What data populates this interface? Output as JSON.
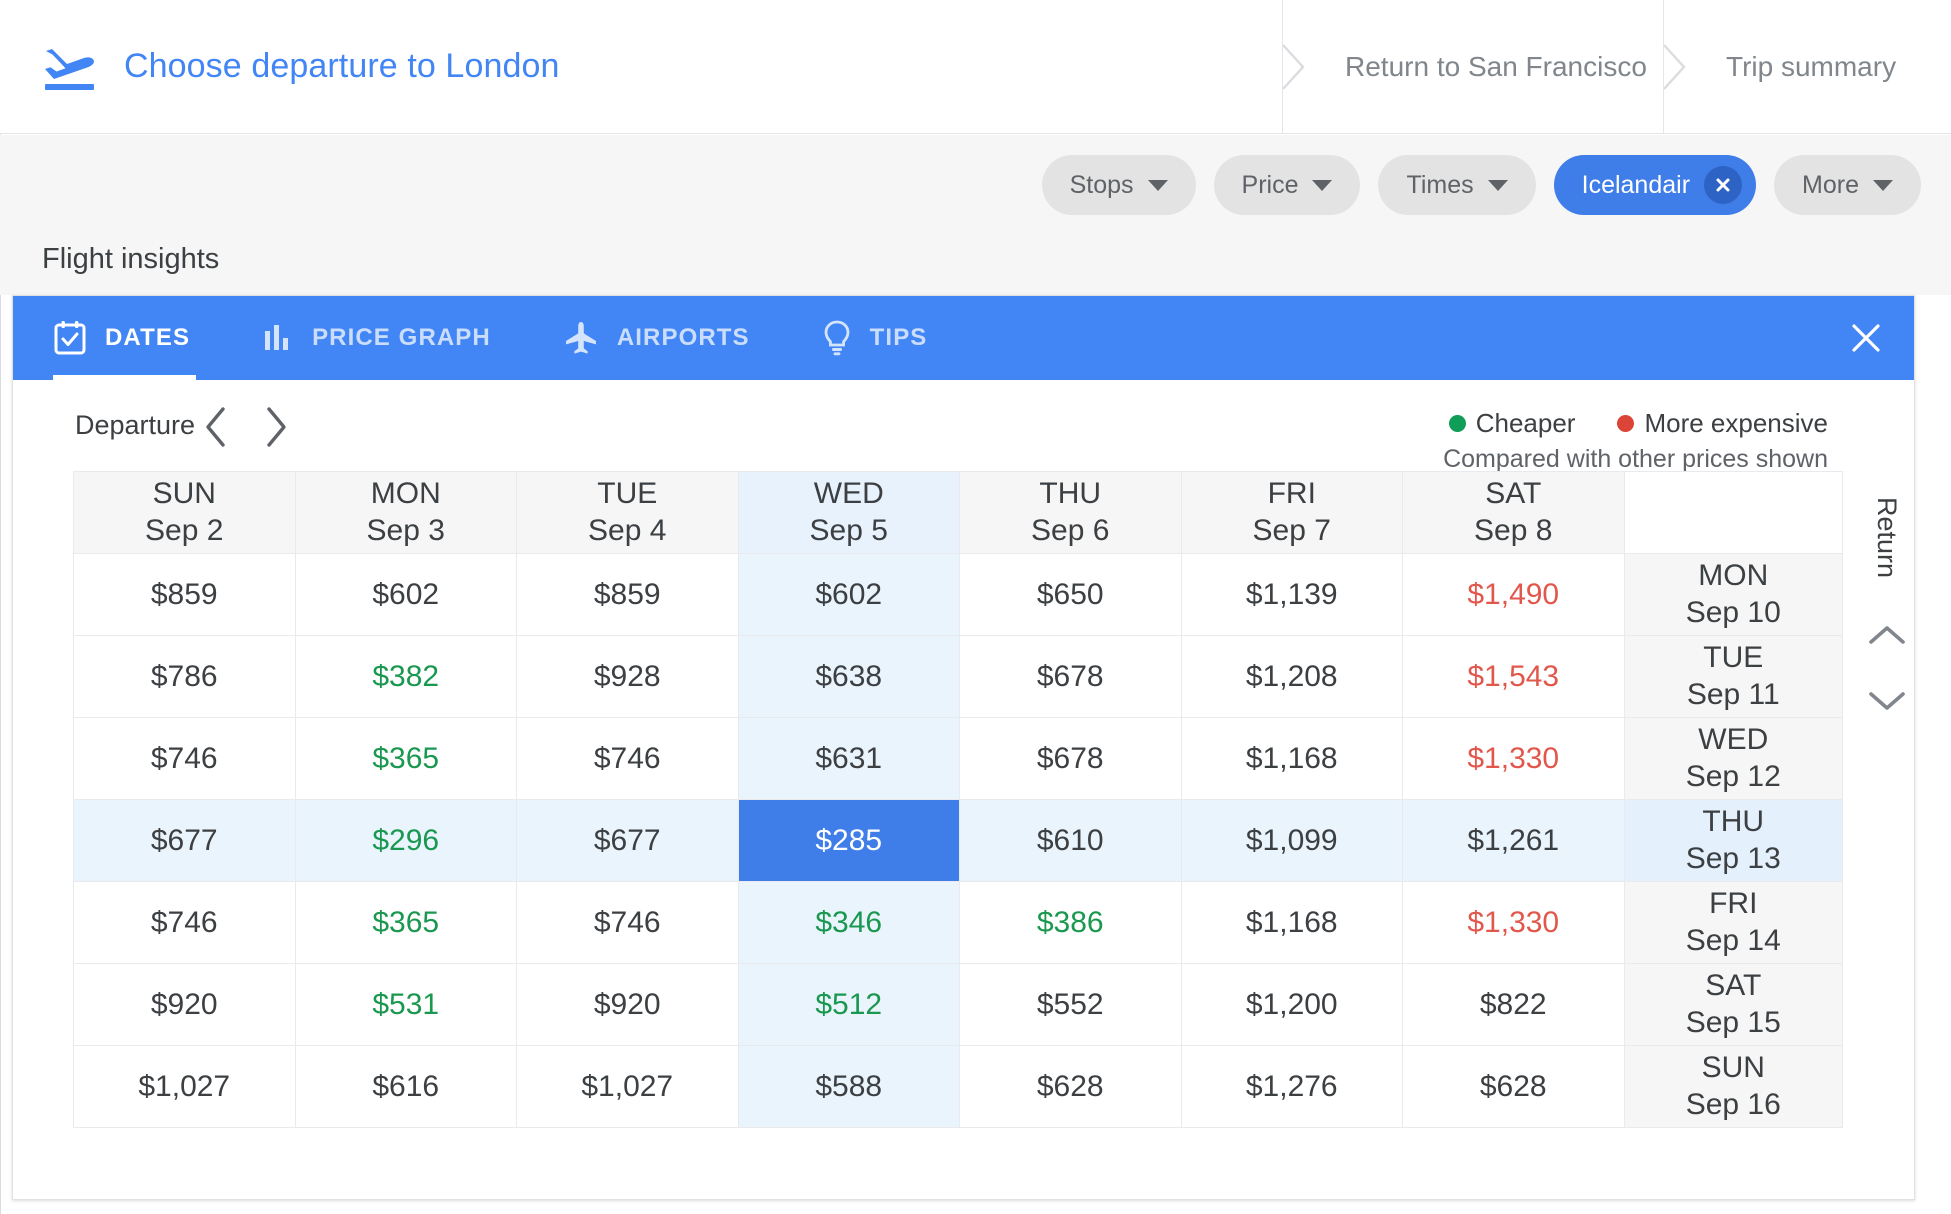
{
  "header": {
    "plane_icon": "airplane-landing-icon",
    "active_crumb": "Choose departure to London",
    "crumbs": [
      {
        "label": "Return to San Francisco"
      },
      {
        "label": "Trip summary"
      }
    ]
  },
  "filters": {
    "chips": [
      {
        "label": "Stops",
        "type": "dropdown",
        "active": false
      },
      {
        "label": "Price",
        "type": "dropdown",
        "active": false
      },
      {
        "label": "Times",
        "type": "dropdown",
        "active": false
      },
      {
        "label": "Icelandair",
        "type": "removable",
        "active": true
      },
      {
        "label": "More",
        "type": "dropdown",
        "active": false
      }
    ]
  },
  "insights": {
    "title": "Flight insights",
    "tabs": [
      {
        "label": "DATES",
        "icon": "calendar-check-icon",
        "selected": true
      },
      {
        "label": "PRICE GRAPH",
        "icon": "bar-chart-icon",
        "selected": false
      },
      {
        "label": "AIRPORTS",
        "icon": "airplane-icon",
        "selected": false
      },
      {
        "label": "TIPS",
        "icon": "lightbulb-icon",
        "selected": false
      }
    ],
    "close_label": "close-icon"
  },
  "controls": {
    "departure_label": "Departure",
    "prev_label": "chevron-left-icon",
    "next_label": "chevron-right-icon",
    "legend": {
      "cheaper": "Cheaper",
      "more_expensive": "More expensive",
      "note": "Compared with other prices shown",
      "cheaper_color": "#0f9d58",
      "expensive_color": "#db4437"
    }
  },
  "rail": {
    "label": "Return",
    "up_label": "chevron-up-icon",
    "down_label": "chevron-down-icon"
  },
  "grid": {
    "columns": [
      {
        "dow": "SUN",
        "date": "Sep 2",
        "highlighted": false
      },
      {
        "dow": "MON",
        "date": "Sep 3",
        "highlighted": false
      },
      {
        "dow": "TUE",
        "date": "Sep 4",
        "highlighted": false
      },
      {
        "dow": "WED",
        "date": "Sep 5",
        "highlighted": true
      },
      {
        "dow": "THU",
        "date": "Sep 6",
        "highlighted": false
      },
      {
        "dow": "FRI",
        "date": "Sep 7",
        "highlighted": false
      },
      {
        "dow": "SAT",
        "date": "Sep 8",
        "highlighted": false
      }
    ],
    "return_column_header": "",
    "rows": [
      {
        "return": {
          "dow": "MON",
          "date": "Sep 10"
        },
        "highlighted": false,
        "cells": [
          {
            "price": "$859",
            "style": "normal"
          },
          {
            "price": "$602",
            "style": "normal"
          },
          {
            "price": "$859",
            "style": "normal"
          },
          {
            "price": "$602",
            "style": "normal"
          },
          {
            "price": "$650",
            "style": "normal"
          },
          {
            "price": "$1,139",
            "style": "normal"
          },
          {
            "price": "$1,490",
            "style": "expensive"
          }
        ]
      },
      {
        "return": {
          "dow": "TUE",
          "date": "Sep 11"
        },
        "highlighted": false,
        "cells": [
          {
            "price": "$786",
            "style": "normal"
          },
          {
            "price": "$382",
            "style": "cheaper"
          },
          {
            "price": "$928",
            "style": "normal"
          },
          {
            "price": "$638",
            "style": "normal"
          },
          {
            "price": "$678",
            "style": "normal"
          },
          {
            "price": "$1,208",
            "style": "normal"
          },
          {
            "price": "$1,543",
            "style": "expensive"
          }
        ]
      },
      {
        "return": {
          "dow": "WED",
          "date": "Sep 12"
        },
        "highlighted": false,
        "cells": [
          {
            "price": "$746",
            "style": "normal"
          },
          {
            "price": "$365",
            "style": "cheaper"
          },
          {
            "price": "$746",
            "style": "normal"
          },
          {
            "price": "$631",
            "style": "normal"
          },
          {
            "price": "$678",
            "style": "normal"
          },
          {
            "price": "$1,168",
            "style": "normal"
          },
          {
            "price": "$1,330",
            "style": "expensive"
          }
        ]
      },
      {
        "return": {
          "dow": "THU",
          "date": "Sep 13"
        },
        "highlighted": true,
        "cells": [
          {
            "price": "$677",
            "style": "normal"
          },
          {
            "price": "$296",
            "style": "cheaper"
          },
          {
            "price": "$677",
            "style": "normal"
          },
          {
            "price": "$285",
            "style": "selected"
          },
          {
            "price": "$610",
            "style": "normal"
          },
          {
            "price": "$1,099",
            "style": "normal"
          },
          {
            "price": "$1,261",
            "style": "normal"
          }
        ]
      },
      {
        "return": {
          "dow": "FRI",
          "date": "Sep 14"
        },
        "highlighted": false,
        "cells": [
          {
            "price": "$746",
            "style": "normal"
          },
          {
            "price": "$365",
            "style": "cheaper"
          },
          {
            "price": "$746",
            "style": "normal"
          },
          {
            "price": "$346",
            "style": "cheaper"
          },
          {
            "price": "$386",
            "style": "cheaper"
          },
          {
            "price": "$1,168",
            "style": "normal"
          },
          {
            "price": "$1,330",
            "style": "expensive"
          }
        ]
      },
      {
        "return": {
          "dow": "SAT",
          "date": "Sep 15"
        },
        "highlighted": false,
        "cells": [
          {
            "price": "$920",
            "style": "normal"
          },
          {
            "price": "$531",
            "style": "cheaper"
          },
          {
            "price": "$920",
            "style": "normal"
          },
          {
            "price": "$512",
            "style": "cheaper"
          },
          {
            "price": "$552",
            "style": "normal"
          },
          {
            "price": "$1,200",
            "style": "normal"
          },
          {
            "price": "$822",
            "style": "normal"
          }
        ]
      },
      {
        "return": {
          "dow": "SUN",
          "date": "Sep 16"
        },
        "highlighted": false,
        "cells": [
          {
            "price": "$1,027",
            "style": "normal"
          },
          {
            "price": "$616",
            "style": "normal"
          },
          {
            "price": "$1,027",
            "style": "normal"
          },
          {
            "price": "$588",
            "style": "normal"
          },
          {
            "price": "$628",
            "style": "normal"
          },
          {
            "price": "$1,276",
            "style": "normal"
          },
          {
            "price": "$628",
            "style": "normal"
          }
        ]
      }
    ]
  },
  "colors": {
    "accent": "#4285f4",
    "selected_cell": "#3f7de8",
    "cheaper_text": "#1a9850",
    "expensive_text": "#e2574c",
    "column_highlight": "#eaf4fd",
    "chip_active": "#3f7de8"
  }
}
